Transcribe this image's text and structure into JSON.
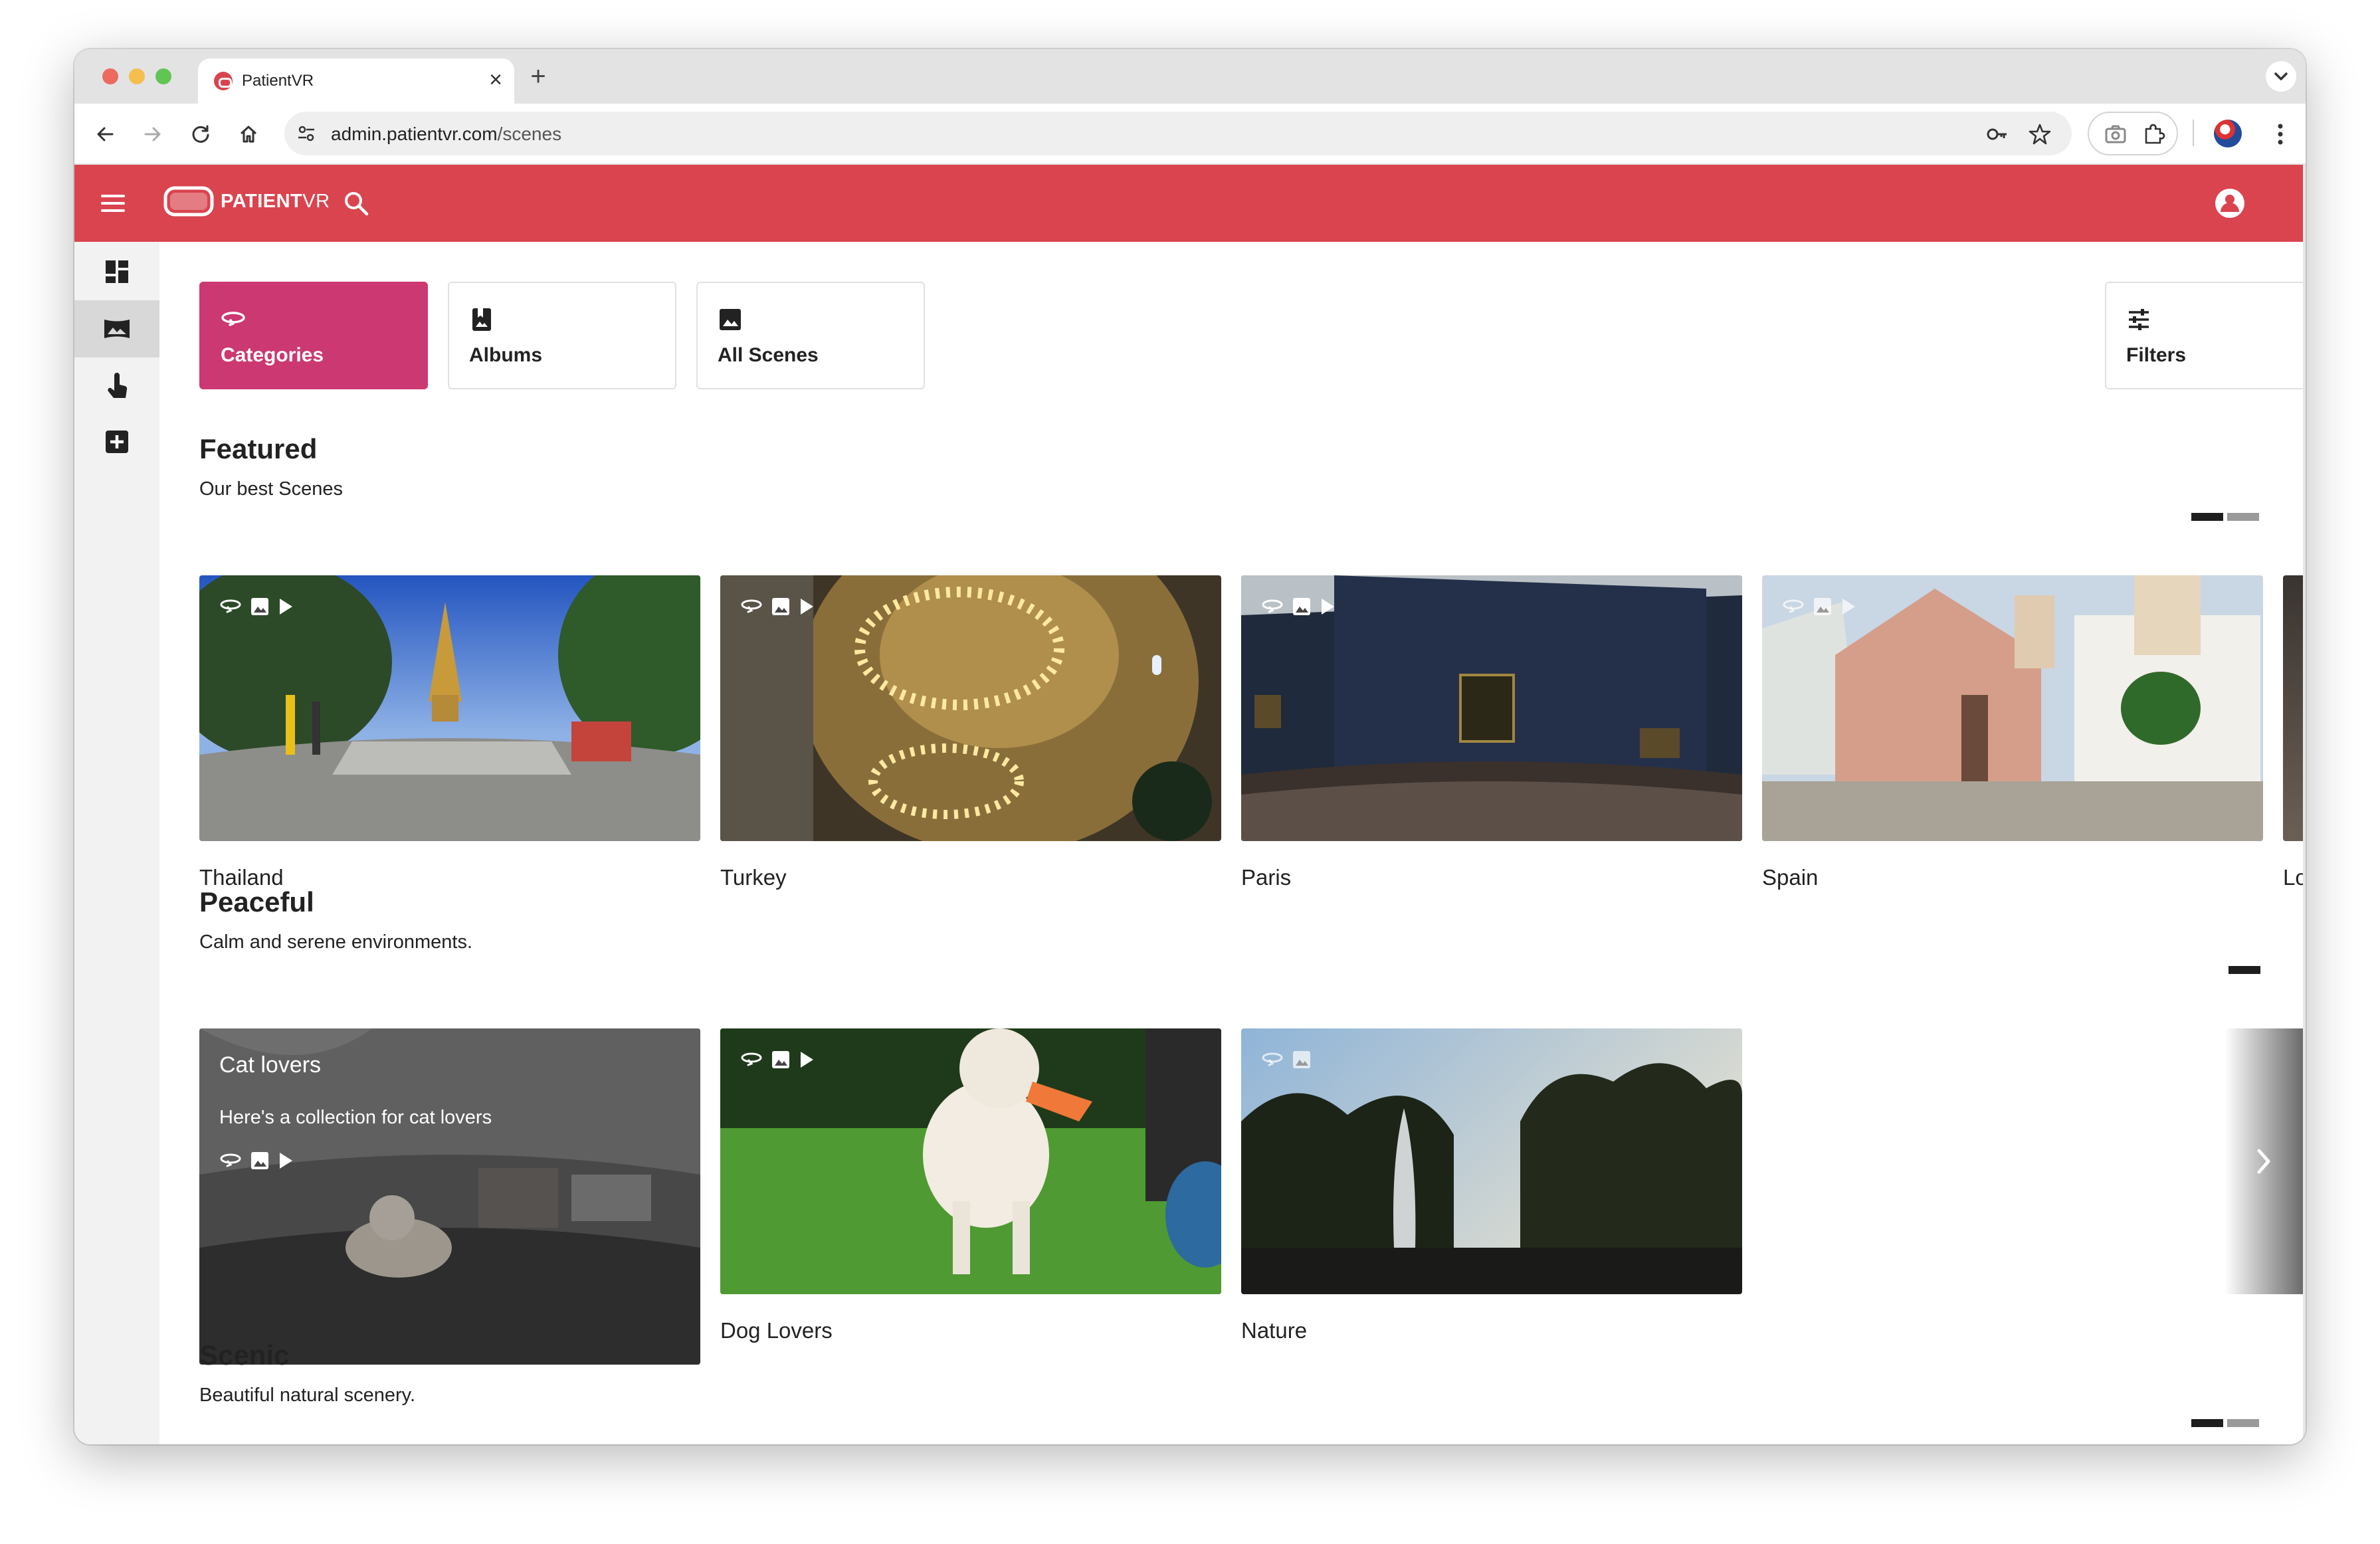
{
  "browser": {
    "tab_title": "PatientVR",
    "url_host": "admin.patientvr.com",
    "url_path": "/scenes"
  },
  "app": {
    "brand_bold": "PATIENT",
    "brand_thin": "VR"
  },
  "tabs": [
    {
      "label": "Categories",
      "icon": "categories-icon",
      "active": true
    },
    {
      "label": "Albums",
      "icon": "album-icon",
      "active": false
    },
    {
      "label": "All Scenes",
      "icon": "image-icon",
      "active": false
    }
  ],
  "filters_label": "Filters",
  "sections": [
    {
      "title": "Featured",
      "subtitle": "Our best Scenes",
      "cards": [
        {
          "label": "Thailand"
        },
        {
          "label": "Turkey"
        },
        {
          "label": "Paris"
        },
        {
          "label": "Spain"
        },
        {
          "label": "Lo"
        }
      ]
    },
    {
      "title": "Peaceful",
      "subtitle": "Calm and serene environments.",
      "cards": [
        {
          "label": "Cat lovers",
          "description": "Here's a collection for cat lovers"
        },
        {
          "label": "Dog Lovers"
        },
        {
          "label": "Nature"
        }
      ]
    },
    {
      "title": "Scenic",
      "subtitle": "Beautiful natural scenery.",
      "cards": []
    }
  ],
  "colors": {
    "appbar": "#d9444f",
    "active_tab": "#cc3871"
  }
}
